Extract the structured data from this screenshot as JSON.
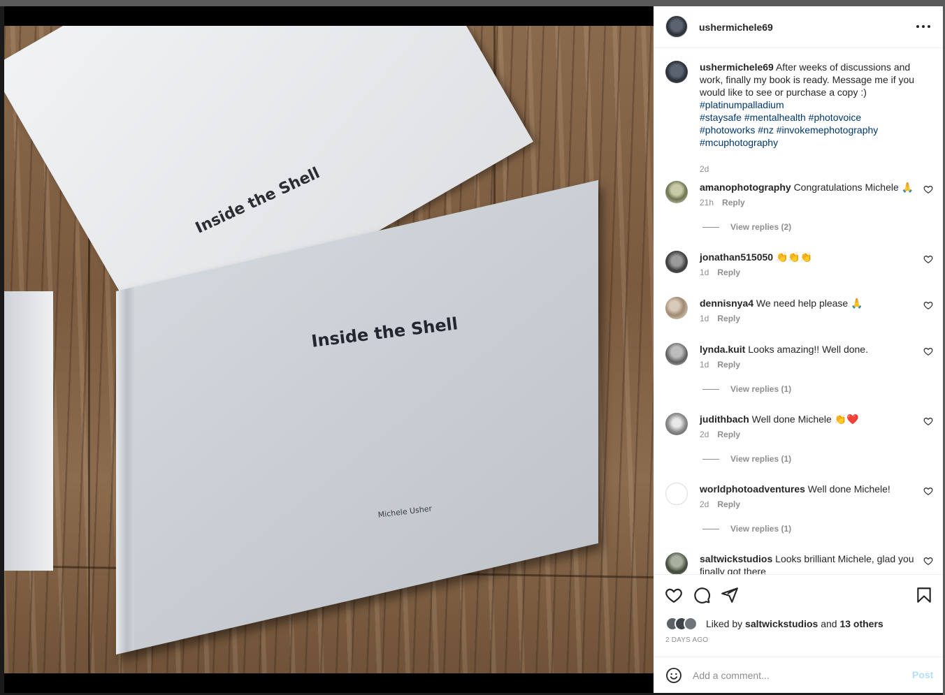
{
  "post": {
    "username": "ushermichele69",
    "caption": "After weeks of discussions and work, finally my book is ready. Message me if you would like to see or purchase a copy :)",
    "hashtags_line1": "#platinumpalladium",
    "hashtags_line2": "#staysafe #mentalhealth #photovoice",
    "hashtags_line3": "#photoworks #nz #invokemephotography",
    "hashtags_line4": "#mcuphotography",
    "age": "2d"
  },
  "photo": {
    "back_book_title": "Inside the Shell",
    "front_book_title": "Inside the Shell",
    "front_book_author": "Michele Usher"
  },
  "comments": [
    {
      "username": "amanophotography",
      "text": "Congratulations Michele 🙏",
      "age": "21h",
      "reply": "Reply",
      "view_replies": "View replies (2)"
    },
    {
      "username": "jonathan515050",
      "text": "👏👏👏",
      "age": "1d",
      "reply": "Reply"
    },
    {
      "username": "dennisnya4",
      "text": "We need help please 🙏",
      "age": "1d",
      "reply": "Reply"
    },
    {
      "username": "lynda.kuit",
      "text": "Looks amazing!! Well done.",
      "age": "1d",
      "reply": "Reply",
      "view_replies": "View replies (1)"
    },
    {
      "username": "judithbach",
      "text": "Well done Michele 👏❤️",
      "age": "2d",
      "reply": "Reply",
      "view_replies": "View replies (1)"
    },
    {
      "username": "worldphotoadventures",
      "text": "Well done Michele!",
      "age": "2d",
      "reply": "Reply",
      "view_replies": "View replies (1)"
    },
    {
      "username": "saltwickstudios",
      "text": "Looks brilliant Michele, glad you finally got there",
      "age": "",
      "reply": ""
    }
  ],
  "likes": {
    "prefix": "Liked by",
    "user": "saltwickstudios",
    "and": "and",
    "others": "13 others"
  },
  "timestamp": "2 DAYS AGO",
  "add_comment": {
    "placeholder": "Add a comment...",
    "post_label": "Post"
  },
  "icons": {
    "more": "more-horizontal-icon",
    "like": "heart-icon",
    "comment": "comment-icon",
    "share": "send-icon",
    "save": "bookmark-icon",
    "emoji": "emoji-icon"
  },
  "colors": {
    "text": "#262626",
    "secondary": "#8e8e8e",
    "hashtag": "#00376b",
    "post_button": "#b2dffc"
  }
}
